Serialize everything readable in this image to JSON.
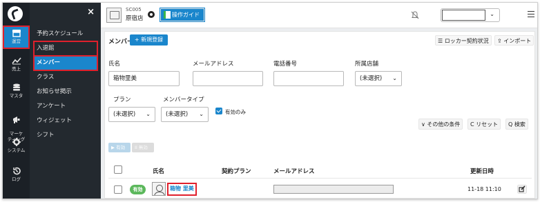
{
  "rail": {
    "items": [
      {
        "label": "運営",
        "icon": "store-icon"
      },
      {
        "label": "売上",
        "icon": "chart-line-icon"
      },
      {
        "label": "マスタ",
        "icon": "database-icon"
      },
      {
        "label": "マーケ\nティング",
        "icon": "megaphone-icon"
      },
      {
        "label": "システム",
        "icon": "gear-icon"
      },
      {
        "label": "ログ",
        "icon": "history-icon"
      }
    ]
  },
  "menu": {
    "close": "×",
    "items": [
      {
        "label": "予約スケジュール"
      },
      {
        "label": "入退館"
      },
      {
        "label": "メンバー"
      },
      {
        "label": "クラス"
      },
      {
        "label": "お知らせ掲示"
      },
      {
        "label": "アンケート"
      },
      {
        "label": "ウィジェット"
      },
      {
        "label": "シフト"
      }
    ]
  },
  "topbar": {
    "shop_code": "SC005",
    "shop_name": "原宿店",
    "guide_label": "操作ガイド",
    "select_value": ""
  },
  "page": {
    "title": "メンバー",
    "new_button": "+ 新規登録",
    "locker_button": "☰ ロッカー契約状況",
    "import_button": "⇪ インポート"
  },
  "filters": {
    "name_label": "氏名",
    "name_value": "箱物里美",
    "email_label": "メールアドレス",
    "email_value": "",
    "phone_label": "電話番号",
    "phone_value": "",
    "store_label": "所属店舗",
    "store_value": "(未選択)",
    "plan_label": "プラン",
    "plan_value": "(未選択)",
    "type_label": "メンバータイプ",
    "type_value": "(未選択)",
    "active_only_label": "有効のみ",
    "active_only_checked": true
  },
  "tools": {
    "other_conditions": "∨ その他の条件",
    "reset": "C リセット",
    "search": "Q 検索"
  },
  "bulk": {
    "start": "▶ 有効",
    "stop": "II 無効"
  },
  "table": {
    "headers": {
      "name": "氏名",
      "plan": "契約プラン",
      "email": "メールアドレス",
      "updated": "更新日時"
    },
    "rows": [
      {
        "status": "有効",
        "name": "箱物 里美",
        "plan": "",
        "email": "",
        "updated": "11-18 11:10"
      }
    ]
  },
  "colors": {
    "accent": "#1a86cc",
    "highlight": "#e0202c",
    "status_active": "#5cb85c",
    "rail_bg": "#1b2026",
    "menu_bg": "#23292f"
  }
}
